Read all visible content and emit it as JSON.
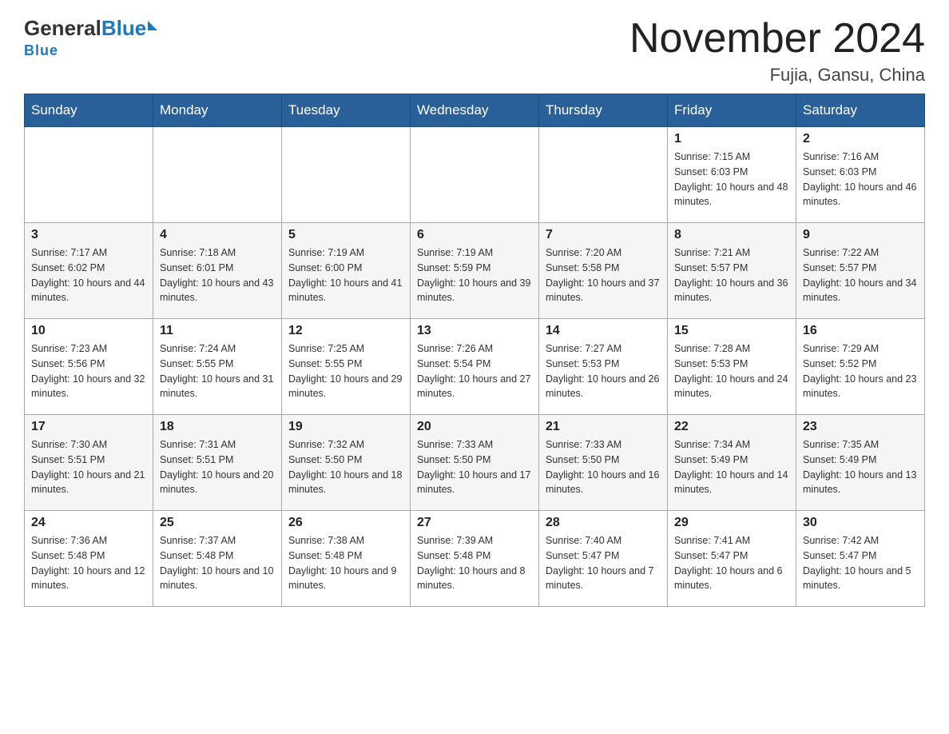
{
  "header": {
    "logo": {
      "general": "General",
      "blue": "Blue"
    },
    "title": "November 2024",
    "subtitle": "Fujia, Gansu, China"
  },
  "weekdays": [
    "Sunday",
    "Monday",
    "Tuesday",
    "Wednesday",
    "Thursday",
    "Friday",
    "Saturday"
  ],
  "weeks": [
    [
      {
        "day": "",
        "sunrise": "",
        "sunset": "",
        "daylight": ""
      },
      {
        "day": "",
        "sunrise": "",
        "sunset": "",
        "daylight": ""
      },
      {
        "day": "",
        "sunrise": "",
        "sunset": "",
        "daylight": ""
      },
      {
        "day": "",
        "sunrise": "",
        "sunset": "",
        "daylight": ""
      },
      {
        "day": "",
        "sunrise": "",
        "sunset": "",
        "daylight": ""
      },
      {
        "day": "1",
        "sunrise": "Sunrise: 7:15 AM",
        "sunset": "Sunset: 6:03 PM",
        "daylight": "Daylight: 10 hours and 48 minutes."
      },
      {
        "day": "2",
        "sunrise": "Sunrise: 7:16 AM",
        "sunset": "Sunset: 6:03 PM",
        "daylight": "Daylight: 10 hours and 46 minutes."
      }
    ],
    [
      {
        "day": "3",
        "sunrise": "Sunrise: 7:17 AM",
        "sunset": "Sunset: 6:02 PM",
        "daylight": "Daylight: 10 hours and 44 minutes."
      },
      {
        "day": "4",
        "sunrise": "Sunrise: 7:18 AM",
        "sunset": "Sunset: 6:01 PM",
        "daylight": "Daylight: 10 hours and 43 minutes."
      },
      {
        "day": "5",
        "sunrise": "Sunrise: 7:19 AM",
        "sunset": "Sunset: 6:00 PM",
        "daylight": "Daylight: 10 hours and 41 minutes."
      },
      {
        "day": "6",
        "sunrise": "Sunrise: 7:19 AM",
        "sunset": "Sunset: 5:59 PM",
        "daylight": "Daylight: 10 hours and 39 minutes."
      },
      {
        "day": "7",
        "sunrise": "Sunrise: 7:20 AM",
        "sunset": "Sunset: 5:58 PM",
        "daylight": "Daylight: 10 hours and 37 minutes."
      },
      {
        "day": "8",
        "sunrise": "Sunrise: 7:21 AM",
        "sunset": "Sunset: 5:57 PM",
        "daylight": "Daylight: 10 hours and 36 minutes."
      },
      {
        "day": "9",
        "sunrise": "Sunrise: 7:22 AM",
        "sunset": "Sunset: 5:57 PM",
        "daylight": "Daylight: 10 hours and 34 minutes."
      }
    ],
    [
      {
        "day": "10",
        "sunrise": "Sunrise: 7:23 AM",
        "sunset": "Sunset: 5:56 PM",
        "daylight": "Daylight: 10 hours and 32 minutes."
      },
      {
        "day": "11",
        "sunrise": "Sunrise: 7:24 AM",
        "sunset": "Sunset: 5:55 PM",
        "daylight": "Daylight: 10 hours and 31 minutes."
      },
      {
        "day": "12",
        "sunrise": "Sunrise: 7:25 AM",
        "sunset": "Sunset: 5:55 PM",
        "daylight": "Daylight: 10 hours and 29 minutes."
      },
      {
        "day": "13",
        "sunrise": "Sunrise: 7:26 AM",
        "sunset": "Sunset: 5:54 PM",
        "daylight": "Daylight: 10 hours and 27 minutes."
      },
      {
        "day": "14",
        "sunrise": "Sunrise: 7:27 AM",
        "sunset": "Sunset: 5:53 PM",
        "daylight": "Daylight: 10 hours and 26 minutes."
      },
      {
        "day": "15",
        "sunrise": "Sunrise: 7:28 AM",
        "sunset": "Sunset: 5:53 PM",
        "daylight": "Daylight: 10 hours and 24 minutes."
      },
      {
        "day": "16",
        "sunrise": "Sunrise: 7:29 AM",
        "sunset": "Sunset: 5:52 PM",
        "daylight": "Daylight: 10 hours and 23 minutes."
      }
    ],
    [
      {
        "day": "17",
        "sunrise": "Sunrise: 7:30 AM",
        "sunset": "Sunset: 5:51 PM",
        "daylight": "Daylight: 10 hours and 21 minutes."
      },
      {
        "day": "18",
        "sunrise": "Sunrise: 7:31 AM",
        "sunset": "Sunset: 5:51 PM",
        "daylight": "Daylight: 10 hours and 20 minutes."
      },
      {
        "day": "19",
        "sunrise": "Sunrise: 7:32 AM",
        "sunset": "Sunset: 5:50 PM",
        "daylight": "Daylight: 10 hours and 18 minutes."
      },
      {
        "day": "20",
        "sunrise": "Sunrise: 7:33 AM",
        "sunset": "Sunset: 5:50 PM",
        "daylight": "Daylight: 10 hours and 17 minutes."
      },
      {
        "day": "21",
        "sunrise": "Sunrise: 7:33 AM",
        "sunset": "Sunset: 5:50 PM",
        "daylight": "Daylight: 10 hours and 16 minutes."
      },
      {
        "day": "22",
        "sunrise": "Sunrise: 7:34 AM",
        "sunset": "Sunset: 5:49 PM",
        "daylight": "Daylight: 10 hours and 14 minutes."
      },
      {
        "day": "23",
        "sunrise": "Sunrise: 7:35 AM",
        "sunset": "Sunset: 5:49 PM",
        "daylight": "Daylight: 10 hours and 13 minutes."
      }
    ],
    [
      {
        "day": "24",
        "sunrise": "Sunrise: 7:36 AM",
        "sunset": "Sunset: 5:48 PM",
        "daylight": "Daylight: 10 hours and 12 minutes."
      },
      {
        "day": "25",
        "sunrise": "Sunrise: 7:37 AM",
        "sunset": "Sunset: 5:48 PM",
        "daylight": "Daylight: 10 hours and 10 minutes."
      },
      {
        "day": "26",
        "sunrise": "Sunrise: 7:38 AM",
        "sunset": "Sunset: 5:48 PM",
        "daylight": "Daylight: 10 hours and 9 minutes."
      },
      {
        "day": "27",
        "sunrise": "Sunrise: 7:39 AM",
        "sunset": "Sunset: 5:48 PM",
        "daylight": "Daylight: 10 hours and 8 minutes."
      },
      {
        "day": "28",
        "sunrise": "Sunrise: 7:40 AM",
        "sunset": "Sunset: 5:47 PM",
        "daylight": "Daylight: 10 hours and 7 minutes."
      },
      {
        "day": "29",
        "sunrise": "Sunrise: 7:41 AM",
        "sunset": "Sunset: 5:47 PM",
        "daylight": "Daylight: 10 hours and 6 minutes."
      },
      {
        "day": "30",
        "sunrise": "Sunrise: 7:42 AM",
        "sunset": "Sunset: 5:47 PM",
        "daylight": "Daylight: 10 hours and 5 minutes."
      }
    ]
  ]
}
